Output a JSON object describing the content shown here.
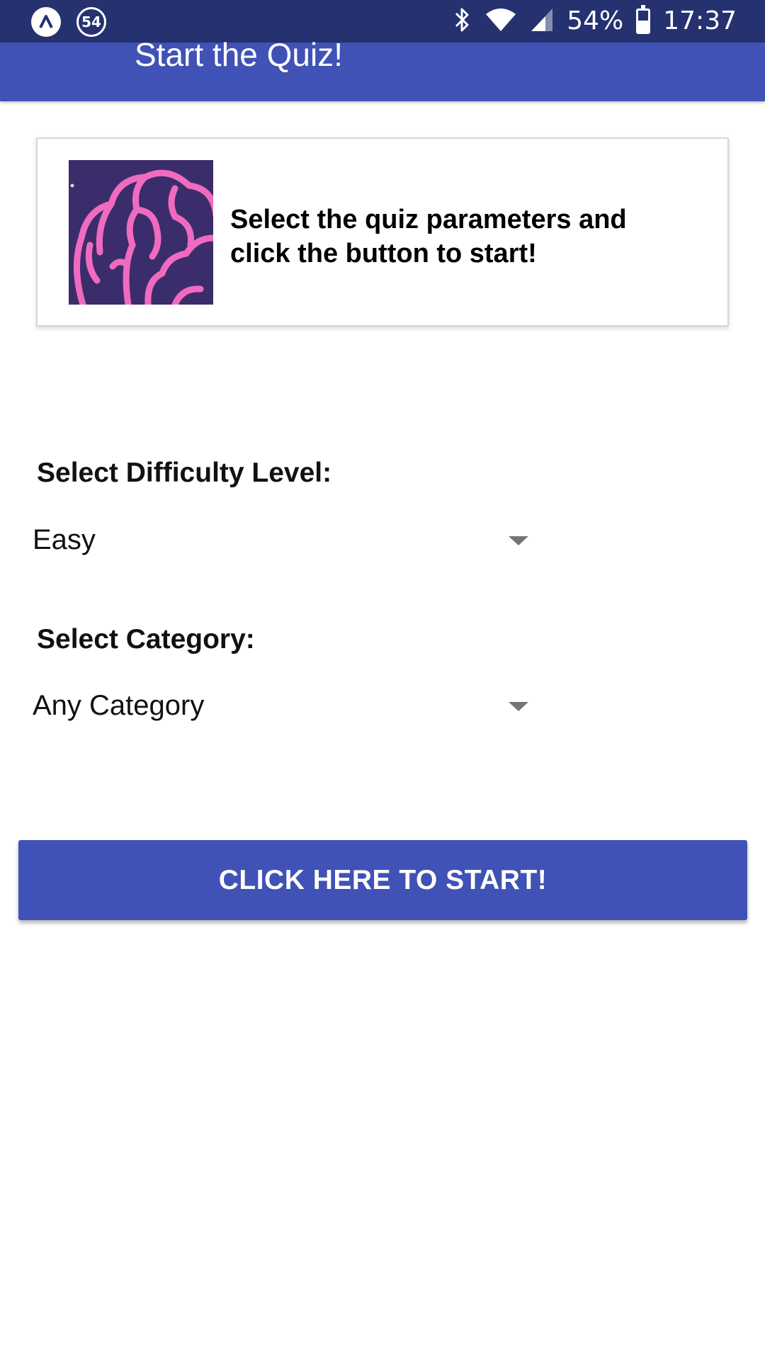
{
  "status_bar": {
    "notification_count": "54",
    "battery_percent": "54%",
    "battery_level": 0.54,
    "time": "17:37",
    "icons": [
      "app-logo-icon",
      "notification-badge-icon",
      "bluetooth-icon",
      "wifi-icon",
      "cell-signal-icon",
      "battery-icon"
    ]
  },
  "app_bar": {
    "title": "Start the Quiz!"
  },
  "intro_card": {
    "image_icon": "brain-icon",
    "text": "Select the quiz parameters and click the button to start!"
  },
  "difficulty": {
    "label": "Select Difficulty Level:",
    "selected": "Easy"
  },
  "category": {
    "label": "Select Category:",
    "selected": "Any Category"
  },
  "start_button": {
    "label": "CLICK HERE TO START!"
  },
  "colors": {
    "status_bar": "#263170",
    "primary": "#4052b5",
    "brain_bg": "#3b2d6b",
    "brain_stroke": "#f06bbf"
  }
}
